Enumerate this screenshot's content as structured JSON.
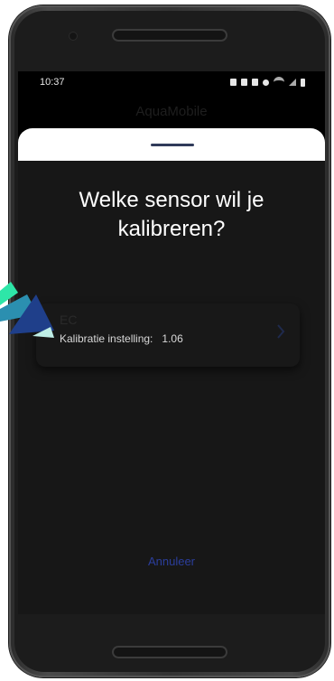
{
  "status_bar": {
    "time": "10:37",
    "icons": [
      "alarm-icon",
      "notification-icon",
      "mute-icon",
      "location-icon",
      "wifi-icon",
      "signal-icon",
      "battery-icon"
    ]
  },
  "app_bar": {
    "title": "AquaMobile"
  },
  "sheet": {
    "heading": "Welke sensor wil je kalibreren?",
    "sensors": [
      {
        "name": "EC",
        "detail_label": "Kalibratie instelling:",
        "detail_value": "1.06"
      }
    ],
    "cancel_label": "Annuleer"
  },
  "page_indicator": {
    "count": 4,
    "active_index": 0
  },
  "colors": {
    "accent": "#3a6ee8",
    "cancel": "#2b3e9c",
    "heading": "#ffffff",
    "sheet_bg": "#171717",
    "handle": "#303b5a"
  }
}
